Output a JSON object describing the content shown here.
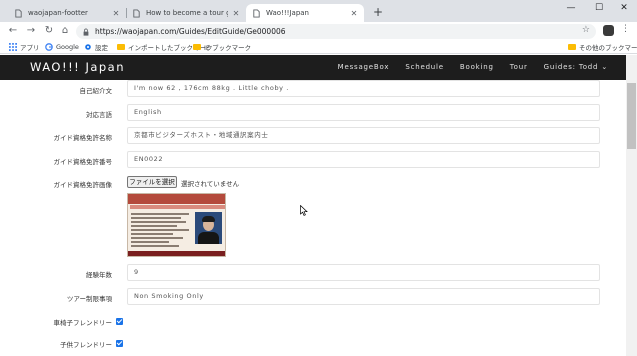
{
  "browser": {
    "tabs": [
      {
        "title": "waojapan-footter"
      },
      {
        "title": "How to become a tour guide of"
      },
      {
        "title": "Wao!!!Japan"
      }
    ],
    "url": "https://waojapan.com/Guides/EditGuide/Ge000006",
    "bookmarks": [
      "アプリ",
      "Google",
      "設定",
      "インポートしたブックマーク",
      "IE ブックマーク"
    ],
    "other_bookmarks": "その他のブックマーク"
  },
  "site": {
    "brand": "WAO!!! Japan",
    "nav": [
      "MessageBox",
      "Schedule",
      "Booking",
      "Tour",
      "Guides: Todd ⌄"
    ]
  },
  "form": {
    "intro_label": "自己紹介文",
    "intro_value": "I'm now 62 , 176cm 88kg . Little choby .",
    "language_label": "対応言語",
    "language_value": "English",
    "license_name_label": "ガイド資格免許名称",
    "license_name_value": "京都市ビジターズホスト・地域通訳案内士",
    "license_number_label": "ガイド資格免許番号",
    "license_number_value": "EN0022",
    "license_image_label": "ガイド資格免許画像",
    "file_button": "ファイルを選択",
    "file_status": "選択されていません",
    "experience_label": "経験年数",
    "experience_value": "9",
    "restrictions_label": "ツアー制限事項",
    "restrictions_value": "Non Smoking  Only",
    "wheelchair_label": "車椅子フレンドリー",
    "child_label": "子供フレンドリー"
  }
}
